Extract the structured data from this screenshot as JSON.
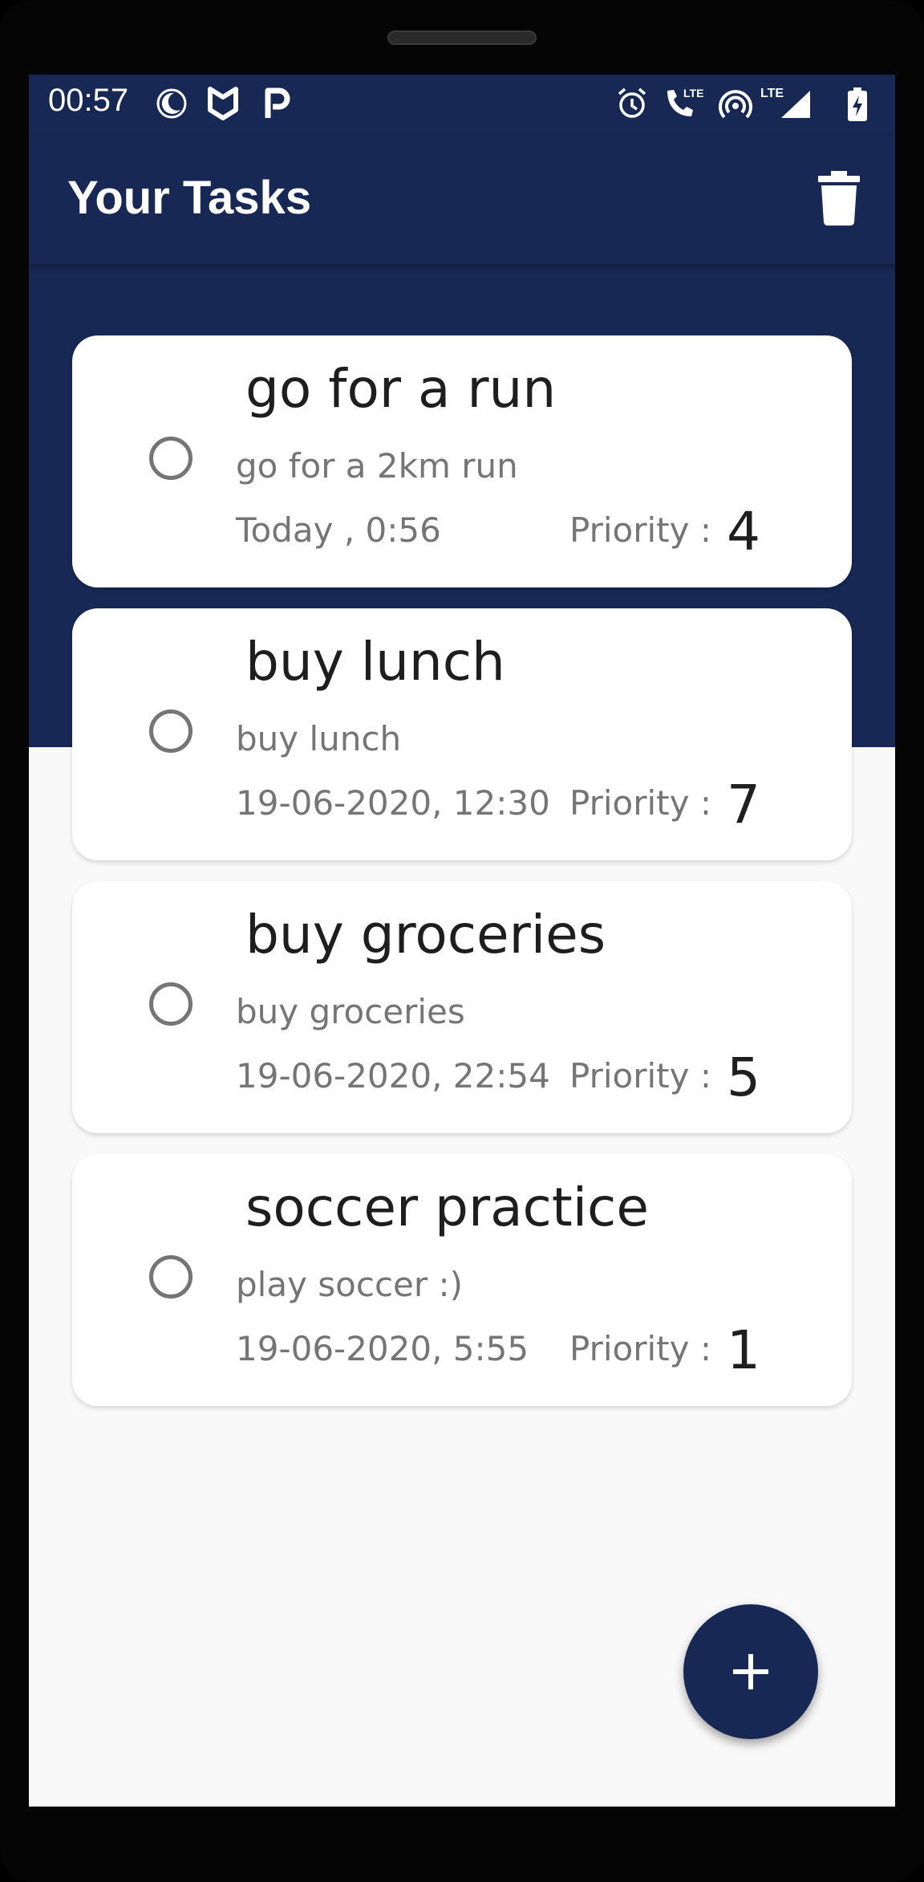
{
  "status_bar": {
    "time": "00:57",
    "left_icons": [
      "moon-icon",
      "shield-icon",
      "parking-icon"
    ],
    "right_icons": [
      "alarm-icon",
      "lte-call-icon",
      "hotspot-icon",
      "lte-signal-icon",
      "battery-charging-icon"
    ],
    "lte_label": "LTE"
  },
  "app_bar": {
    "title": "Your Tasks",
    "action_icon": "trash-icon"
  },
  "tasks": [
    {
      "title": "go for a run",
      "description": "go for a 2km run",
      "date": "Today , 0:56",
      "priority_label": "Priority :",
      "priority": "4"
    },
    {
      "title": "buy lunch",
      "description": "buy lunch",
      "date": "19-06-2020, 12:30",
      "priority_label": "Priority :",
      "priority": "7"
    },
    {
      "title": "buy groceries",
      "description": "buy groceries",
      "date": "19-06-2020, 22:54",
      "priority_label": "Priority :",
      "priority": "5"
    },
    {
      "title": "soccer practice",
      "description": "play soccer :)",
      "date": "19-06-2020, 5:55",
      "priority_label": "Priority :",
      "priority": "1"
    }
  ],
  "fab": {
    "icon": "plus-icon"
  },
  "colors": {
    "primary": "#162853",
    "background": "#f9f9f9",
    "card": "#ffffff",
    "secondary_text": "#757575"
  }
}
